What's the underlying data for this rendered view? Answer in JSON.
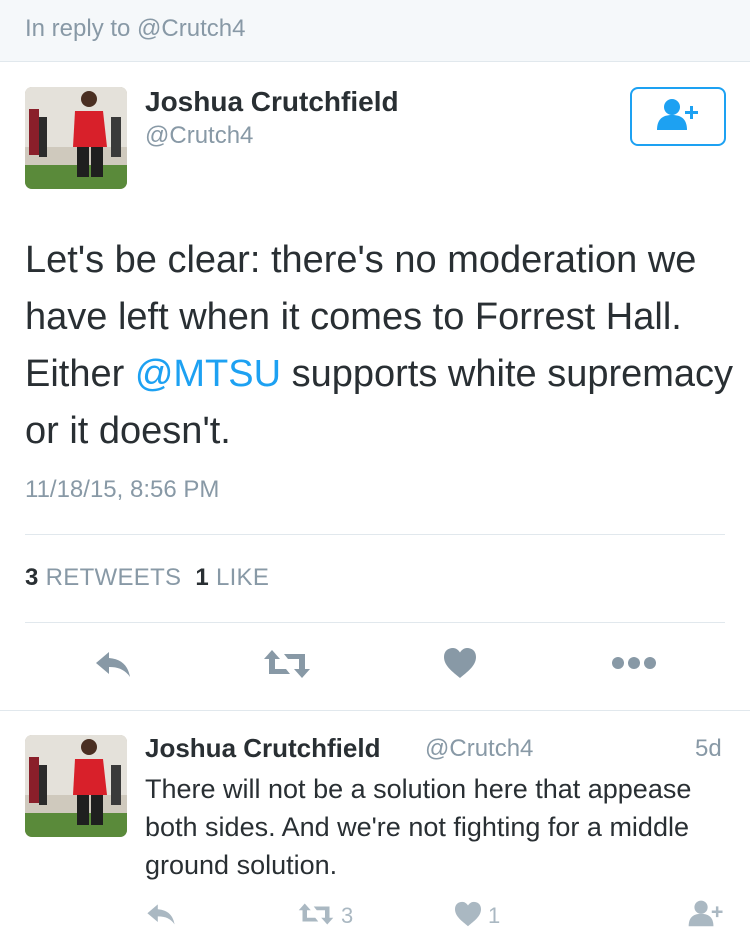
{
  "reply_context": "In reply to @Crutch4",
  "main_tweet": {
    "author_name": "Joshua Crutchfield",
    "author_handle": "@Crutch4",
    "text_before": "Let's be clear: there's no moderation we have left when it comes to Forrest Hall. Either ",
    "mention": "@MTSU",
    "text_after": " supports white supremacy or it doesn't.",
    "timestamp": "11/18/15, 8:56 PM",
    "retweet_count": "3",
    "retweet_label": "RETWEETS",
    "like_count": "1",
    "like_label": "LIKE"
  },
  "reply_tweet": {
    "author_name": "Joshua Crutchfield",
    "author_handle": "@Crutch4",
    "age": "5d",
    "text": "There will not be a solution here that appease both sides. And we're not fighting for a middle ground solution.",
    "retweet_count": "3",
    "like_count": "1"
  },
  "icons": [
    "reply-icon",
    "retweet-icon",
    "heart-icon",
    "more-icon",
    "follow-icon"
  ],
  "colors": {
    "accent": "#1da1f2",
    "muted": "#8899a6",
    "icon": "#8899a6",
    "icon_light": "#aab8c2"
  }
}
